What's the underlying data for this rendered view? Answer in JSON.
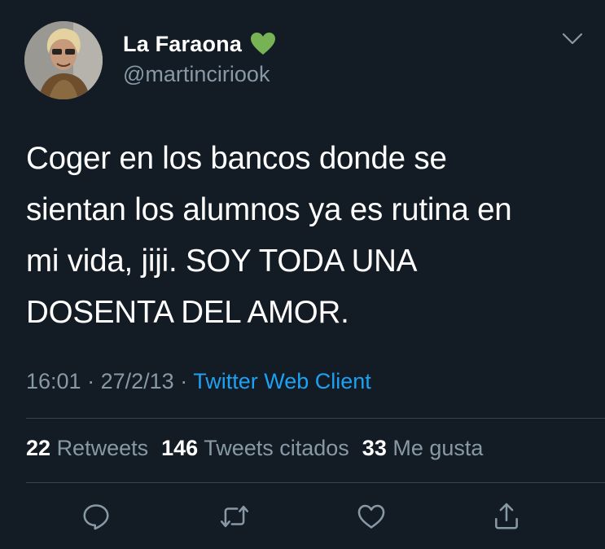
{
  "user": {
    "display_name": "La Faraona",
    "handle": "@martinciriook",
    "name_emoji": "green-heart-icon"
  },
  "tweet": {
    "text": "Coger en los bancos donde se\nsientan los alumnos ya es rutina en\nmi vida, jiji. SOY TODA UNA\nDOSENTA DEL AMOR.",
    "time": "16:01",
    "date": "27/2/13",
    "separator": "·",
    "client": "Twitter Web Client"
  },
  "stats": {
    "retweets_count": "22",
    "retweets_label": "Retweets",
    "quotes_count": "146",
    "quotes_label": "Tweets citados",
    "likes_count": "33",
    "likes_label": "Me gusta"
  },
  "actions": [
    {
      "icon": "reply-icon"
    },
    {
      "icon": "retweet-icon"
    },
    {
      "icon": "like-icon"
    },
    {
      "icon": "share-icon"
    }
  ],
  "colors": {
    "background": "#131b24",
    "secondary_text": "#8899a6",
    "link": "#1da1f2",
    "divider": "#38444d",
    "emoji_green": "#77b255"
  }
}
